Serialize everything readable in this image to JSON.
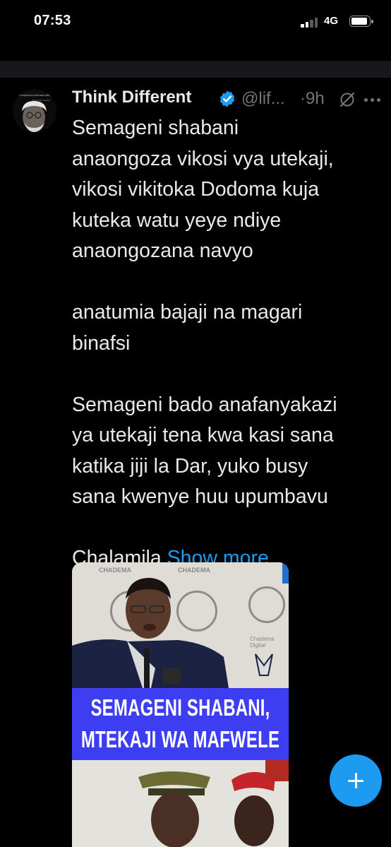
{
  "status_bar": {
    "time": "07:53",
    "network": "4G"
  },
  "tweet": {
    "author_name": "Think Different",
    "handle": "@lif...",
    "time_ago": "9h",
    "lines": [
      "Semageni shabani",
      "anaongoza vikosi vya utekaji,",
      "vikosi vikitoka Dodoma kuja",
      "kuteka watu yeye ndiye",
      "anaongozana navyo",
      "",
      "anatumia bajaji na magari",
      "binafsi",
      "",
      "Semageni bado anafanyakazi",
      "ya utekaji tena kwa kasi sana",
      "katika jiji la Dar, yuko busy",
      "sana kwenye huu upumbavu",
      ""
    ],
    "last_line_start": "Chalamila",
    "show_more": "Show more"
  },
  "media": {
    "caption_line1": "SEMAGENI SHABANI,",
    "caption_line2": "MTEKAJI WA MAFWELE",
    "backdrop_label": "CHADEMA",
    "backdrop_label_2": "Chadema Digital"
  },
  "avatar": {
    "quote": "He is rich enough today but if you hustle tomorrow could be yours",
    "attribution": "-Prof. Wole Soyinka"
  },
  "colors": {
    "accent": "#1d9bf0",
    "caption_bg": "#3d3ef2",
    "background": "#000000",
    "muted": "#71767b"
  },
  "icons": {
    "verified": "verified-badge-icon",
    "grok": "grok-icon",
    "more": "more-dots-icon",
    "compose": "plus-icon"
  }
}
